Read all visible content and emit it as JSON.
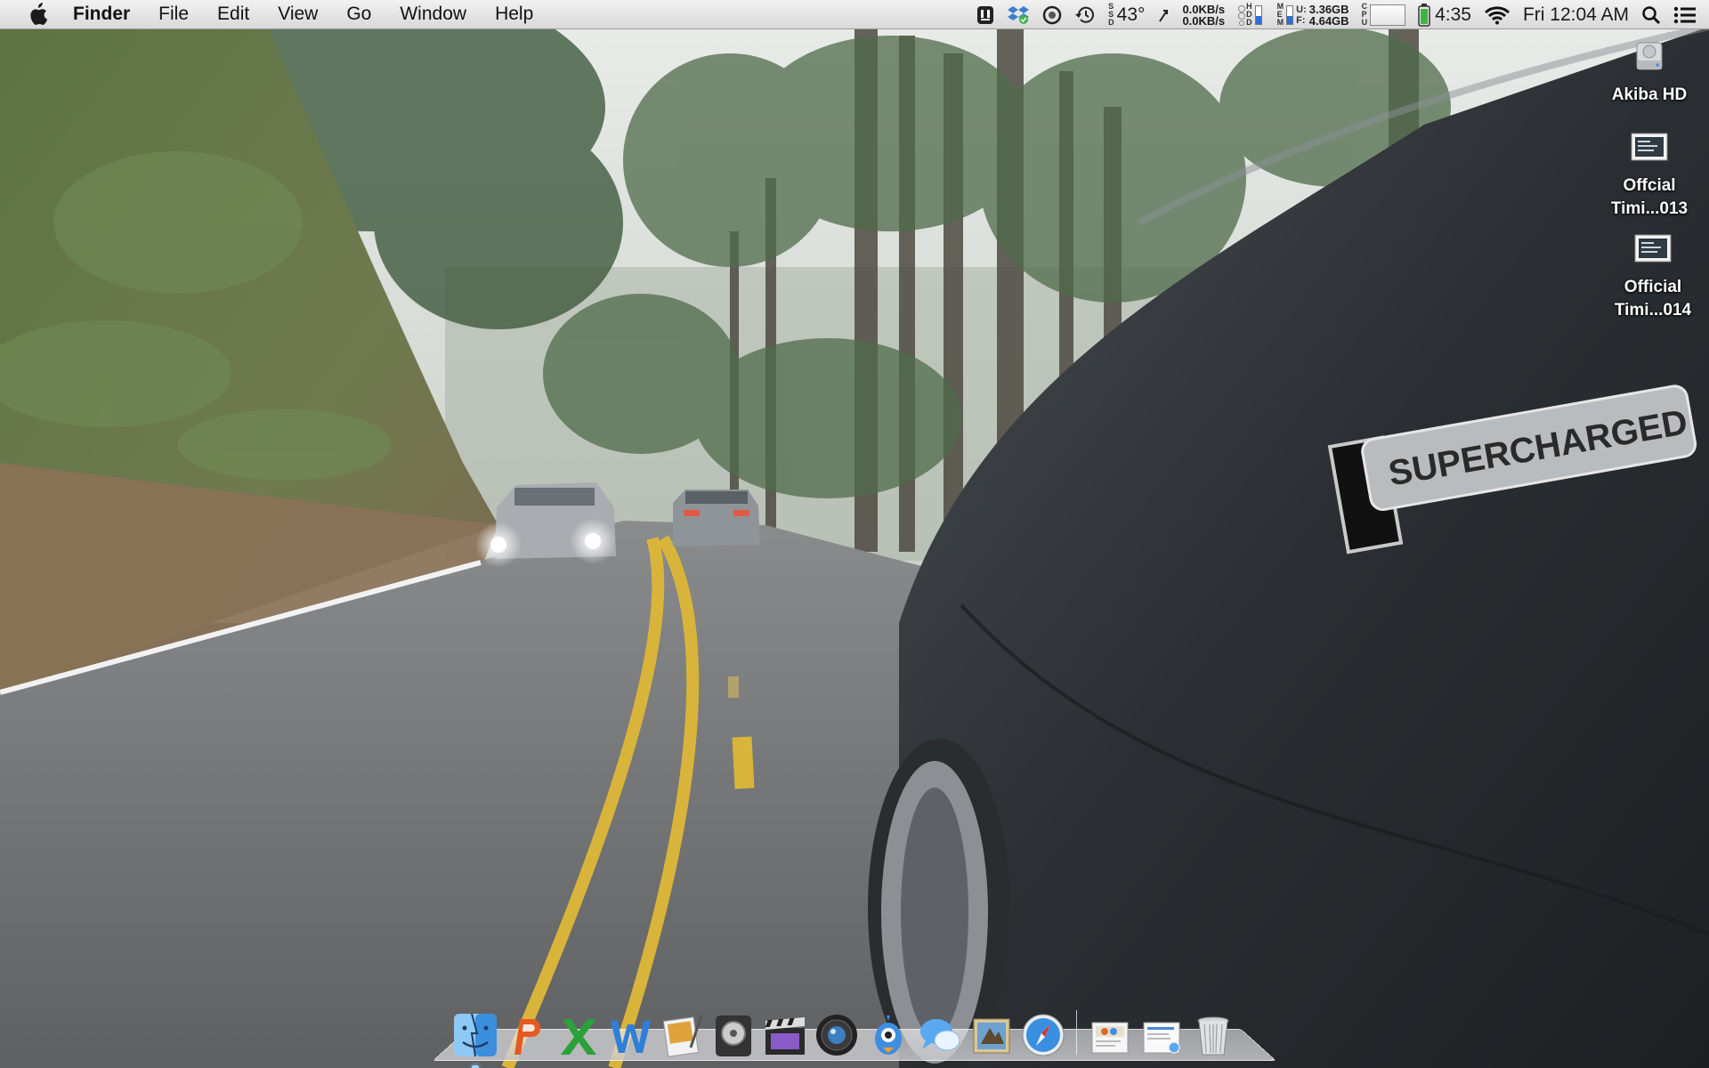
{
  "menubar": {
    "app_name": "Finder",
    "menus": [
      "File",
      "Edit",
      "View",
      "Go",
      "Window",
      "Help"
    ],
    "weather": "43°",
    "net_up": "0.0KB/s",
    "net_down": "0.0KB/s",
    "hdd_label": [
      "H",
      "D",
      "D"
    ],
    "mem_label": [
      "M",
      "E",
      "M"
    ],
    "mem_uf_label": [
      "U:",
      "F:"
    ],
    "mem_used": "3.36GB",
    "mem_free": "4.64GB",
    "cpu_label": [
      "C",
      "P",
      "U"
    ],
    "ssd_label": [
      "S",
      "S",
      "D"
    ],
    "battery_time": "4:35",
    "clock": "Fri 12:04 AM"
  },
  "desktop_icons": [
    {
      "label": "Akiba HD",
      "icon": "hard-drive-icon"
    },
    {
      "label_lines": [
        "Offcial",
        "Timi...013"
      ],
      "icon": "screenshot-file-icon"
    },
    {
      "label_lines": [
        "Official",
        "Timi...014"
      ],
      "icon": "screenshot-file-icon"
    }
  ],
  "wallpaper": {
    "badge_text": "SUPERCHARGED"
  },
  "dock": {
    "apps": [
      {
        "name": "finder-icon",
        "running": true
      },
      {
        "name": "powerpoint-icon",
        "running": false
      },
      {
        "name": "excel-icon",
        "running": false
      },
      {
        "name": "word-icon",
        "running": false
      },
      {
        "name": "preview-icon",
        "running": false
      },
      {
        "name": "logic-icon",
        "running": false
      },
      {
        "name": "final-cut-icon",
        "running": false
      },
      {
        "name": "aperture-icon",
        "running": false
      },
      {
        "name": "tweetbot-icon",
        "running": false
      },
      {
        "name": "messages-icon",
        "running": false
      },
      {
        "name": "mail-icon",
        "running": false
      },
      {
        "name": "safari-icon",
        "running": false
      }
    ],
    "stacks": [
      "documents-stack-icon",
      "downloads-stack-icon",
      "trash-icon"
    ]
  },
  "colors": {
    "menubar_bg": "#e6e6e6",
    "road": "#6e6e70",
    "lane_yellow": "#d9b43a",
    "car_body": "#2e3236",
    "foliage": "#4f6b4a"
  }
}
